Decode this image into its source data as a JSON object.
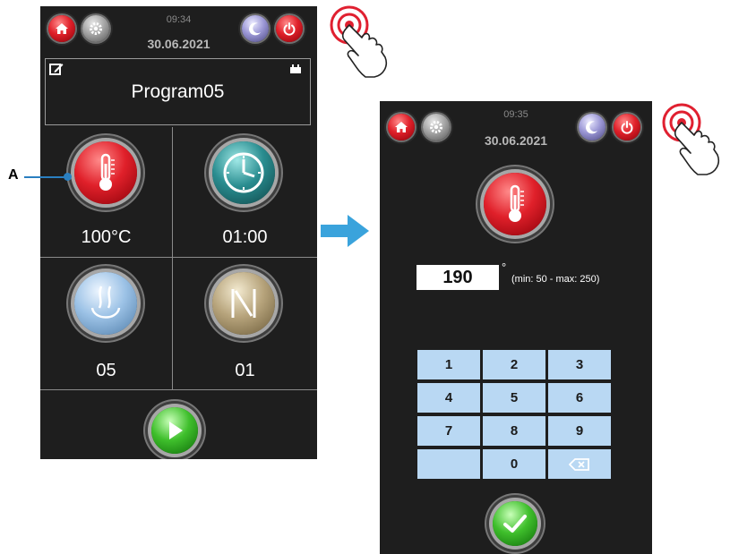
{
  "callout": {
    "label": "A"
  },
  "left_screen": {
    "time": "09:34",
    "date": "30.06.2021",
    "program_name": "Program05",
    "tiles": [
      {
        "label": "100°C",
        "icon": "thermometer-icon"
      },
      {
        "label": "01:00",
        "icon": "clock-icon"
      },
      {
        "label": "05",
        "icon": "steam-icon"
      },
      {
        "label": "01",
        "icon": "damper-icon"
      }
    ],
    "start_icon": "play-icon"
  },
  "right_screen": {
    "time": "09:35",
    "date": "30.06.2021",
    "value": "190",
    "unit": "°",
    "range_text": "(min: 50 - max: 250)",
    "keys": [
      "1",
      "2",
      "3",
      "4",
      "5",
      "6",
      "7",
      "8",
      "9",
      "",
      "0"
    ],
    "confirm_icon": "check-icon"
  },
  "colors": {
    "panel": "#1e1e1e",
    "accent_arrow": "#3aa3dc",
    "touch_ring": "#e02030",
    "keypad": "#b9d8f3"
  }
}
